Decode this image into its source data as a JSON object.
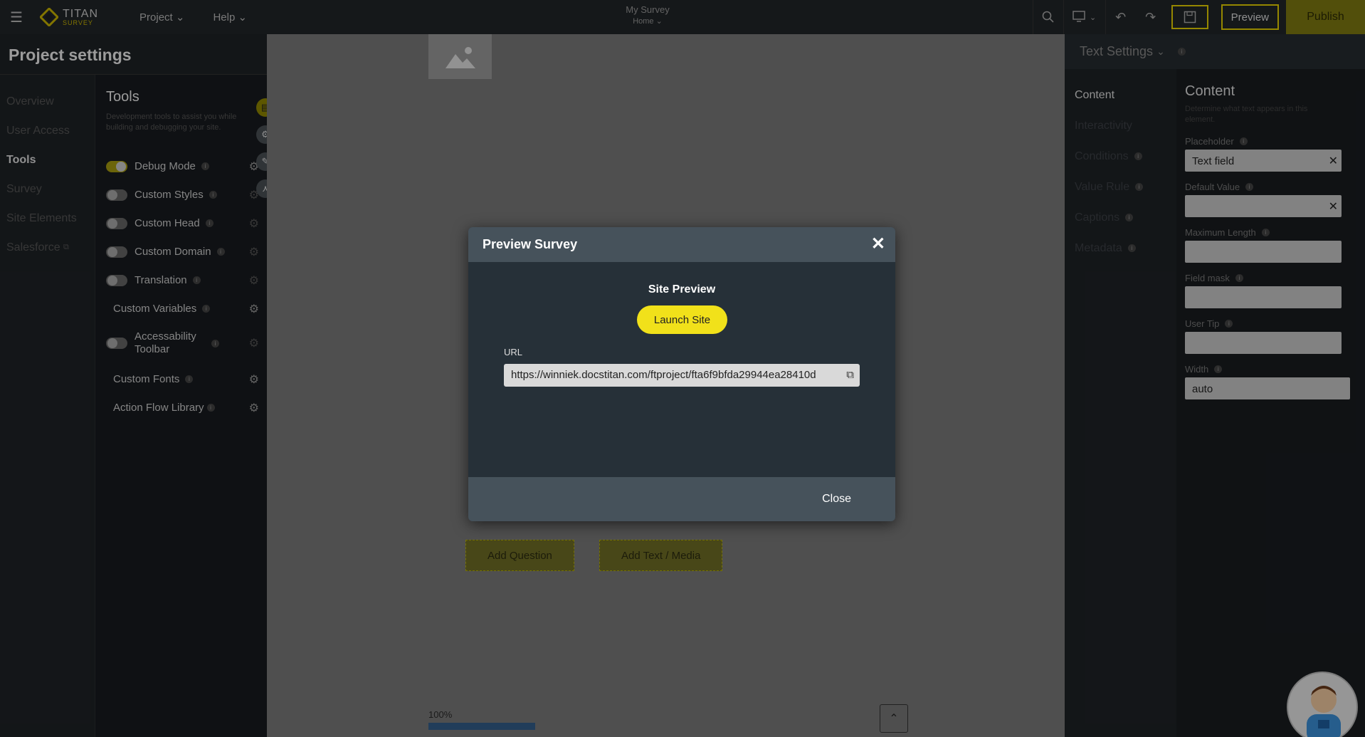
{
  "topbar": {
    "logo_title": "TITAN",
    "logo_sub": "SURVEY",
    "menu": [
      "Project",
      "Help"
    ],
    "project_title": "My Survey",
    "project_page": "Home",
    "preview_label": "Preview",
    "publish_label": "Publish"
  },
  "project_settings": {
    "title": "Project settings",
    "nav": [
      "Overview",
      "User Access",
      "Tools",
      "Survey",
      "Site Elements",
      "Salesforce"
    ],
    "active_nav": "Tools"
  },
  "tools": {
    "title": "Tools",
    "description": "Development tools to assist you while building and debugging your site.",
    "items": [
      {
        "label": "Debug Mode",
        "toggle": "on"
      },
      {
        "label": "Custom Styles",
        "toggle": "off"
      },
      {
        "label": "Custom Head",
        "toggle": "off"
      },
      {
        "label": "Custom Domain",
        "toggle": "off"
      },
      {
        "label": "Translation",
        "toggle": "off"
      },
      {
        "label": "Custom Variables",
        "toggle": "none"
      },
      {
        "label": "Accessability Toolbar",
        "toggle": "off"
      },
      {
        "label": "Custom Fonts",
        "toggle": "none"
      },
      {
        "label": "Action Flow Library",
        "toggle": "none"
      }
    ]
  },
  "canvas": {
    "add_question": "Add Question",
    "add_text_media": "Add Text / Media",
    "progress_label": "100%",
    "progress_value": 1.0
  },
  "text_settings": {
    "header": "Text Settings",
    "nav": [
      "Content",
      "Interactivity",
      "Conditions",
      "Value Rule",
      "Captions",
      "Metadata"
    ],
    "content_title": "Content",
    "content_desc": "Determine what text appears in this element.",
    "fields": [
      {
        "label": "Placeholder",
        "value": "Text field",
        "clearable": true
      },
      {
        "label": "Default Value",
        "value": "",
        "clearable": true
      },
      {
        "label": "Maximum Length",
        "value": ""
      },
      {
        "label": "Field mask",
        "value": ""
      },
      {
        "label": "User Tip",
        "value": ""
      },
      {
        "label": "Width",
        "value": "auto"
      }
    ]
  },
  "modal": {
    "title": "Preview Survey",
    "site_preview": "Site Preview",
    "launch_label": "Launch Site",
    "url_label": "URL",
    "url_value": "https://winniek.docstitan.com/ftproject/fta6f9bfda29944ea28410d",
    "close_label": "Close"
  },
  "colors": {
    "accent": "#f1e11a",
    "publish_bg": "#7f7a12"
  }
}
